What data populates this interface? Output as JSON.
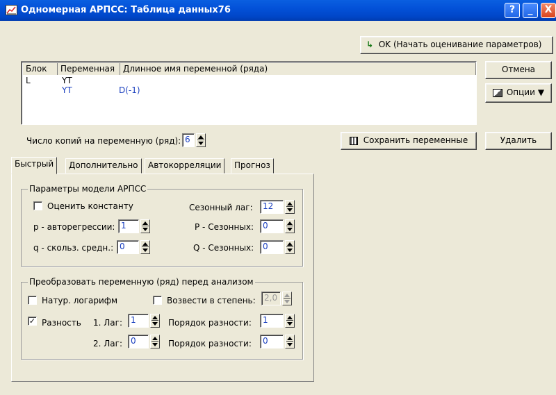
{
  "window": {
    "title": "Одномерная АРПСС: Таблица данных76"
  },
  "titlebar_buttons": {
    "help": "?",
    "minimize": "_",
    "close": "X"
  },
  "toolbar": {
    "ok_label": "OK (Начать оценивание параметров)",
    "cancel_label": "Отмена",
    "options_label": "Опции",
    "save_vars_label": "Сохранить переменные",
    "delete_label": "Удалить"
  },
  "var_table": {
    "headers": [
      "Блок",
      "Переменная",
      "Длинное имя переменной (ряда)"
    ],
    "rows": [
      {
        "block": "L",
        "variable": "YT",
        "long_name": ""
      },
      {
        "block": "",
        "variable": "YT",
        "long_name": "D(-1)"
      }
    ]
  },
  "copies": {
    "label": "Число копий на переменную (ряд):",
    "value": "6"
  },
  "tabs": [
    "Быстрый",
    "Дополнительно",
    "Автокорреляции",
    "Прогноз"
  ],
  "arima_params": {
    "title": "Параметры модели АРПСС",
    "estimate_constant": {
      "label": "Оценить константу",
      "checked": false
    },
    "p_label": "p - авторегрессии:",
    "p_value": "1",
    "q_label": "q - скольз. средн.:",
    "q_value": "0",
    "seasonal_lag_label": "Сезонный лаг:",
    "seasonal_lag_value": "12",
    "P_label": "P - Сезонных:",
    "P_value": "0",
    "Q_label": "Q - Сезонных:",
    "Q_value": "0"
  },
  "transform": {
    "title": "Преобразовать переменную (ряд) перед анализом",
    "natural_log": {
      "label": "Натур. логарифм",
      "checked": false
    },
    "power": {
      "label": "Возвести в степень:",
      "checked": false,
      "value": "2,0"
    },
    "difference": {
      "label": "Разность",
      "checked": true
    },
    "lag1_label": "1. Лаг:",
    "lag1_value": "1",
    "order1_label": "Порядок разности:",
    "order1_value": "1",
    "lag2_label": "2. Лаг:",
    "lag2_value": "0",
    "order2_label": "Порядок разности:",
    "order2_value": "0"
  },
  "colors": {
    "titlebar": "#0351d8",
    "value_text": "#1a3fbf"
  }
}
